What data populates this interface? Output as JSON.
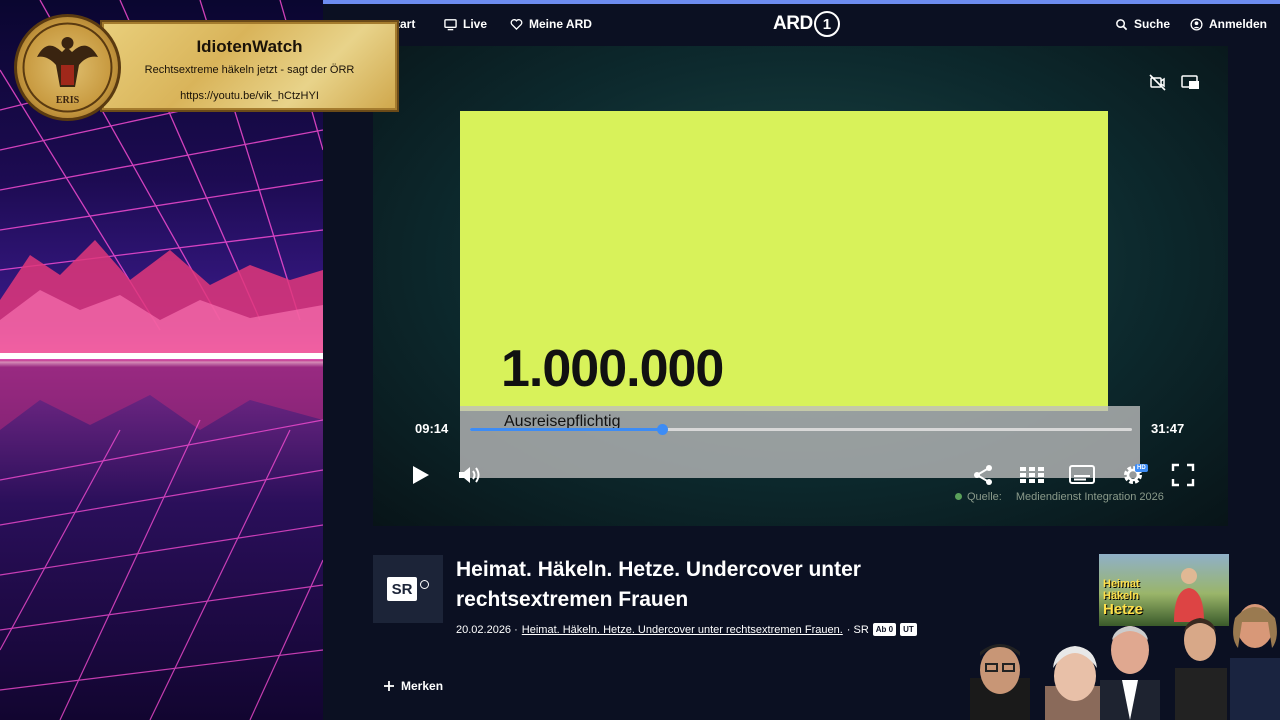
{
  "nav": {
    "start_label": "tart",
    "live_label": "Live",
    "meine_label": "Meine ARD",
    "logo_text": "ARD",
    "logo_number": "1",
    "search_label": "Suche",
    "login_label": "Anmelden"
  },
  "overlay": {
    "title": "IdiotenWatch",
    "subtitle": "Rechtsextreme häkeln jetzt - sagt der ÖRR",
    "url": "https://youtu.be/vik_hCtzHYI",
    "seal_text": "ERIS"
  },
  "player": {
    "slide_number": "1.000.000",
    "subtitle_text": "Ausreisepflichtig",
    "current_time": "09:14",
    "duration": "31:47",
    "progress": 0.29,
    "hd_badge": "HD",
    "source_label": "Quelle:",
    "source_value": "Mediendienst Integration 2026"
  },
  "video": {
    "channel_logo": "SR",
    "title": "Heimat. Häkeln. Hetze. Undercover unter rechtsextremen Frauen",
    "date": "20.02.2026 ·",
    "series_link": "Heimat. Häkeln. Hetze. Undercover unter rechtsextremen Frauen.",
    "channel": "· SR",
    "badge_ad": "Ab 0",
    "badge_ut": "UT",
    "merken_label": "Merken"
  },
  "thumbnail": {
    "line1": "Heimat",
    "line2": "Häkeln",
    "line3": "Hetze"
  },
  "colors": {
    "accent": "#3d8cf5",
    "slide": "#d8f25a",
    "background": "#0b1022"
  }
}
